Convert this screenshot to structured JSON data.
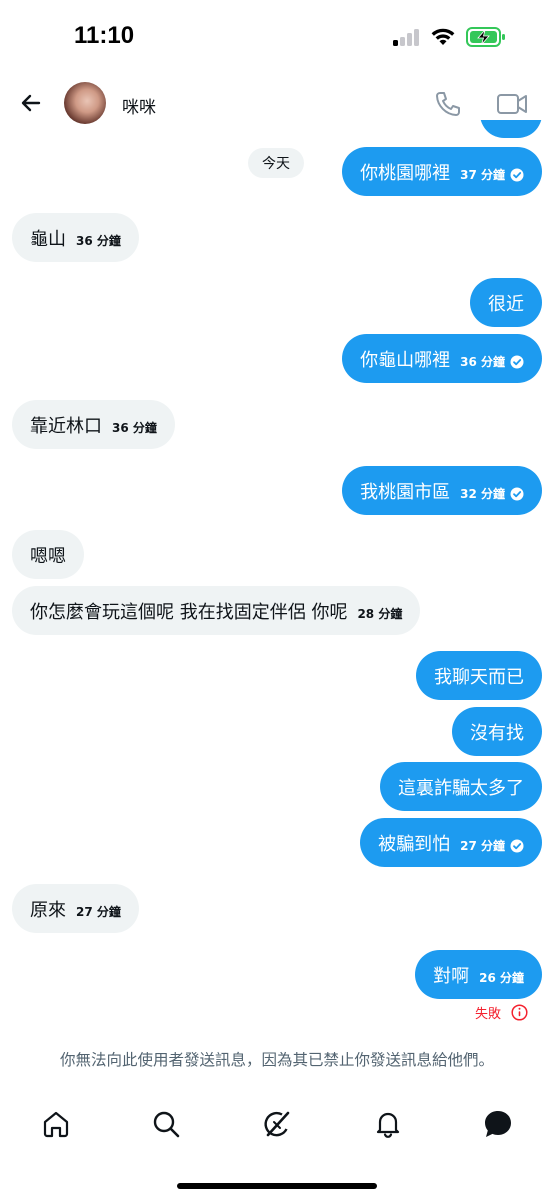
{
  "status_bar": {
    "time": "11:10"
  },
  "header": {
    "contact_name": "咪咪"
  },
  "day_separator": "今天",
  "messages": [
    {
      "dir": "out",
      "text": "你桃園哪裡",
      "time": "37 分鐘",
      "read": true
    },
    {
      "dir": "in",
      "text": "龜山",
      "time": "36 分鐘"
    },
    {
      "dir": "out",
      "text": "很近",
      "time": ""
    },
    {
      "dir": "out",
      "text": "你龜山哪裡",
      "time": "36 分鐘",
      "read": true
    },
    {
      "dir": "in",
      "text": "靠近林口",
      "time": "36 分鐘"
    },
    {
      "dir": "out",
      "text": "我桃園市區",
      "time": "32 分鐘",
      "read": true
    },
    {
      "dir": "in",
      "text": "嗯嗯",
      "time": ""
    },
    {
      "dir": "in",
      "text": "你怎麼會玩這個呢 我在找固定伴侶 你呢",
      "time": "28 分鐘"
    },
    {
      "dir": "out",
      "text": "我聊天而已",
      "time": ""
    },
    {
      "dir": "out",
      "text": "沒有找",
      "time": ""
    },
    {
      "dir": "out",
      "text": "這裏詐騙太多了",
      "time": ""
    },
    {
      "dir": "out",
      "text": "被騙到怕",
      "time": "27 分鐘",
      "read": true
    },
    {
      "dir": "in",
      "text": "原來",
      "time": "27 分鐘"
    },
    {
      "dir": "out",
      "text": "對啊",
      "time": "26 分鐘"
    }
  ],
  "failed_label": "失敗",
  "notice": "你無法向此使用者發送訊息，因為其已禁止你發送訊息給他們。",
  "colors": {
    "accent": "#1d9bf0",
    "incoming_bubble": "#eff3f4",
    "error": "#f4212e",
    "muted": "#536471",
    "battery": "#34c759"
  },
  "nav": [
    "home-icon",
    "search-icon",
    "grok-icon",
    "notifications-icon",
    "messages-icon"
  ]
}
